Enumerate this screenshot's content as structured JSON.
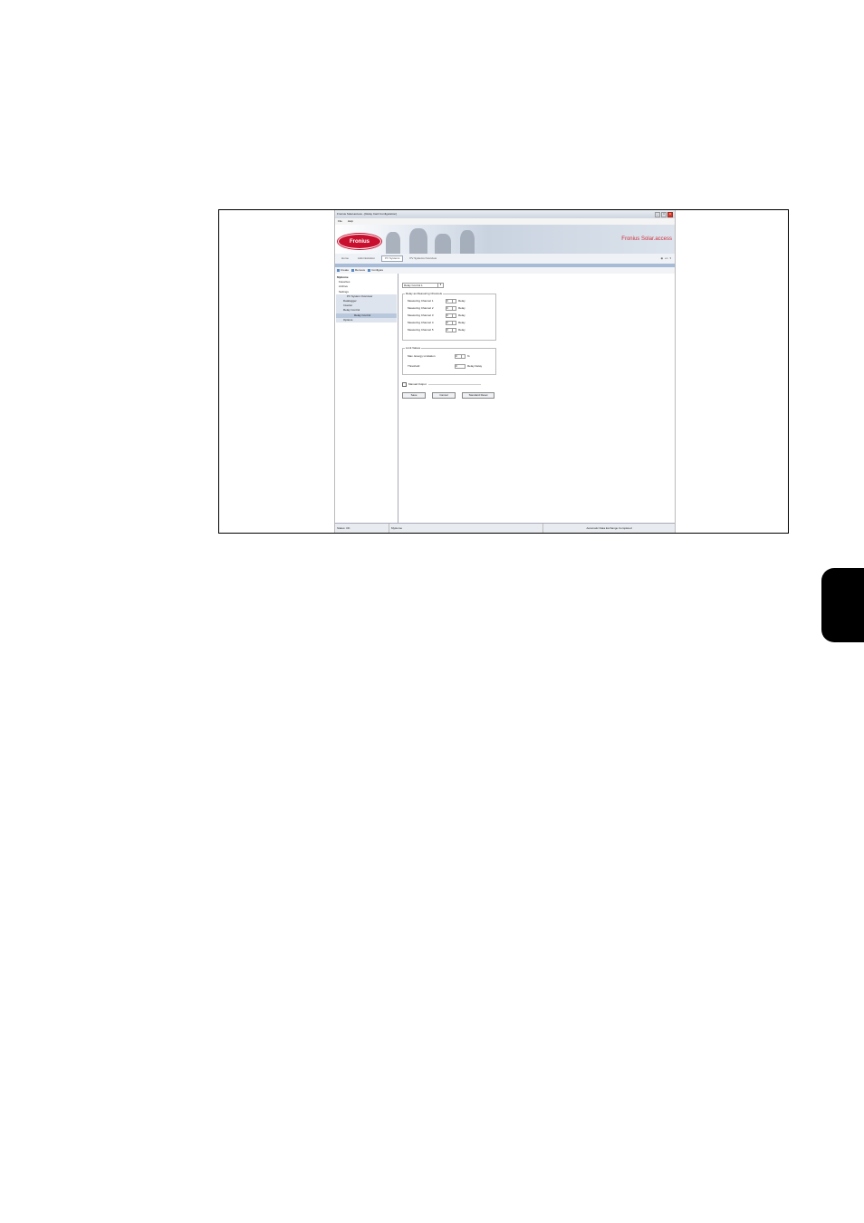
{
  "window": {
    "title": "Fronius Solar.access - [Relay Card Configuration]",
    "controls": [
      "_",
      "□",
      "X"
    ]
  },
  "menu": {
    "items": [
      "File",
      "Help"
    ]
  },
  "banner": {
    "logo_text": "Fronius",
    "brand_text": "Fronius Solar.access",
    "brand_color": "#d0313c"
  },
  "navtabs": {
    "items": [
      "Home",
      "Administration",
      "PV Systems",
      "PV Systems Overview"
    ],
    "active_index": 2,
    "language": "en"
  },
  "toolbar": {
    "items": [
      "Create",
      "Remove",
      "Configure"
    ]
  },
  "tree": {
    "items": [
      {
        "label": "MyHome",
        "level": 0
      },
      {
        "label": "Favorites",
        "level": 0
      },
      {
        "label": "Archive",
        "level": 0
      },
      {
        "label": "Settings",
        "level": 0
      },
      {
        "label": "PV System Overview",
        "level": 2
      },
      {
        "label": "Datalogger",
        "level": 1
      },
      {
        "label": "Inverter",
        "level": 1
      },
      {
        "label": "Relay Control",
        "level": 1
      },
      {
        "label": "Relay Control",
        "level": 2
      },
      {
        "label": "Options",
        "level": 1
      }
    ]
  },
  "form": {
    "select_value": "Relay Control 1",
    "measuring_group_title": "Relay as Measuring Channels",
    "channels": [
      {
        "label": "Measuring Channel 1",
        "value": "0",
        "unit": "Relay"
      },
      {
        "label": "Measuring Channel 2",
        "value": "0",
        "unit": "Relay"
      },
      {
        "label": "Measuring Channel 3",
        "value": "0",
        "unit": "Relay"
      },
      {
        "label": "Measuring Channel 4",
        "value": "0",
        "unit": "Relay"
      },
      {
        "label": "Measuring Channel 5",
        "value": "0",
        "unit": "Relay"
      }
    ],
    "limit_group_title": "Limit Values",
    "limit_rows": [
      {
        "label": "Max. Energy Limitation",
        "value": "0",
        "unit": "%"
      },
      {
        "label": "Threshold",
        "value": "0",
        "unit": "Relay Delay"
      }
    ],
    "checkbox_label": "Manual Output",
    "buttons": {
      "save": "Save",
      "cancel": "Cancel",
      "reset": "Standard Reset"
    }
  },
  "status": {
    "left": "Status: OK",
    "middle": "MyHome",
    "right": "Automatic Data Exchange Completed"
  }
}
